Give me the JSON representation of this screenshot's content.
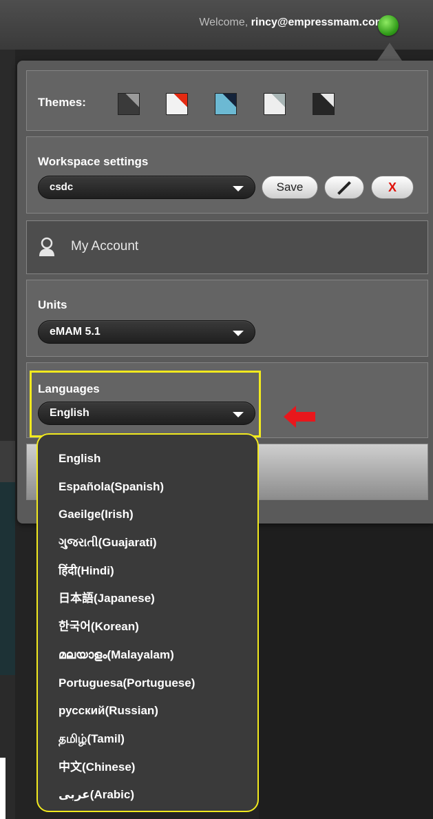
{
  "header": {
    "welcome_prefix": "Welcome,",
    "user_email": "rincy@empressmam.com",
    "status_color": "#3aa81f",
    "status_icon": "online-status-dot"
  },
  "themes": {
    "label": "Themes:",
    "swatches": [
      "dark-gray",
      "white-red",
      "blue",
      "light-gray",
      "black"
    ]
  },
  "workspace": {
    "label": "Workspace settings",
    "selected": "csdc",
    "save_label": "Save",
    "edit_icon": "pencil-icon",
    "delete_label": "X"
  },
  "account": {
    "label": "My Account",
    "icon": "user-icon"
  },
  "units": {
    "label": "Units",
    "selected": "eMAM 5.1"
  },
  "languages": {
    "label": "Languages",
    "selected": "English",
    "options": [
      "English",
      "Española(Spanish)",
      "Gaeilge(Irish)",
      "ગુજરાતી(Guajarati)",
      "हिंदी(Hindi)",
      "日本語(Japanese)",
      "한국어(Korean)",
      "മലയാളം(Malayalam)",
      "Portuguesa(Portuguese)",
      "русский(Russian)",
      "தமிழ்(Tamil)",
      "中文(Chinese)",
      "عربى(Arabic)"
    ]
  },
  "annotation": {
    "highlight_color": "#f2ea1e",
    "arrow_color": "#e8171c"
  }
}
